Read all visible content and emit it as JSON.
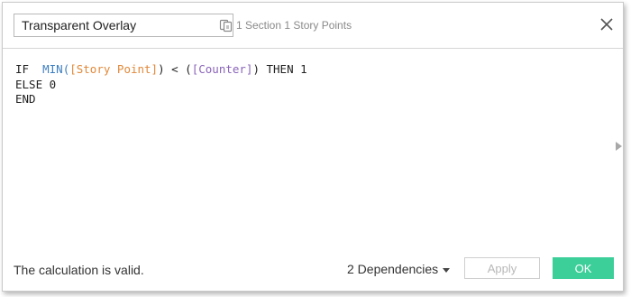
{
  "dialog": {
    "calc_name": "Transparent Overlay",
    "datasource_label": "1 Section 1 Story Points",
    "datasource_icon": "datasource-icon",
    "close_icon": "close-icon"
  },
  "formula": {
    "line1": {
      "if": "IF",
      "fn": "MIN(",
      "field1": "[Story Point]",
      "middle": ") < (",
      "field2": "[Counter]",
      "then": ") THEN 1"
    },
    "line2": "ELSE 0",
    "line3": "END"
  },
  "footer": {
    "status": "The calculation is valid.",
    "dependencies": "2 Dependencies",
    "apply_label": "Apply",
    "ok_label": "OK"
  },
  "colors": {
    "ok_button": "#3ccf9a",
    "function": "#3d7fc0",
    "field_orange": "#e1893a",
    "field_purple": "#8a65b9"
  }
}
